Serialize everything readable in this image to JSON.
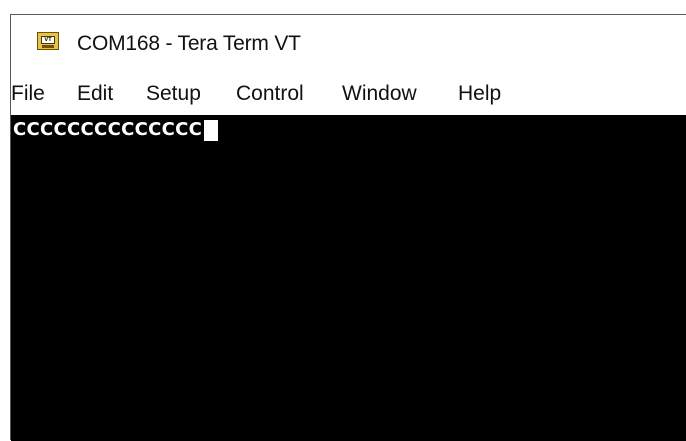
{
  "window": {
    "title": "COM168 - Tera Term VT",
    "icon": "tera-term-vt-icon",
    "icon_text": "VT"
  },
  "menu": {
    "items": [
      {
        "label": "File"
      },
      {
        "label": "Edit"
      },
      {
        "label": "Setup"
      },
      {
        "label": "Control"
      },
      {
        "label": "Window"
      },
      {
        "label": "Help"
      }
    ]
  },
  "terminal": {
    "output": "CCCCCCCCCCCCCC",
    "background": "#000000",
    "foreground": "#ffffff"
  }
}
